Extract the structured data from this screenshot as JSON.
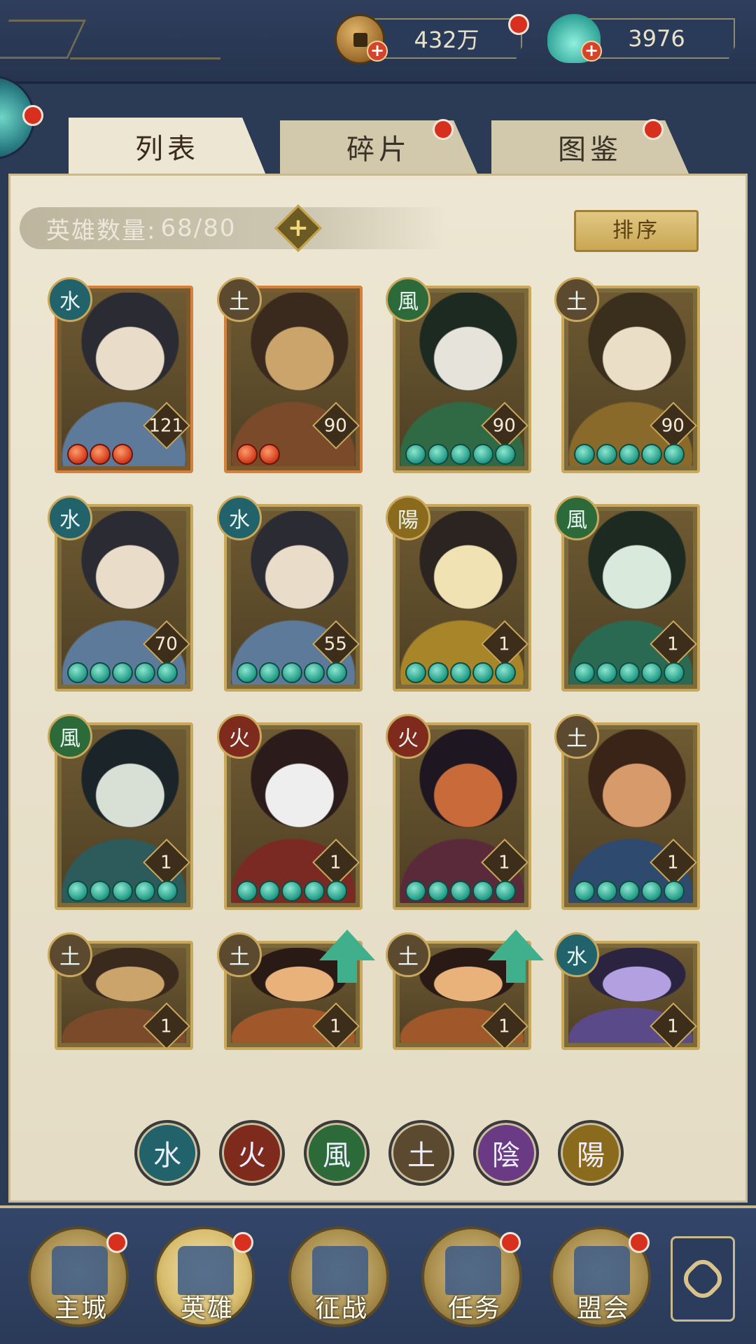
{
  "currencies": {
    "coins": {
      "value": "432万",
      "icon": "copper-coin-icon"
    },
    "shells": {
      "value": "3976",
      "icon": "jade-shell-icon"
    }
  },
  "tabs": [
    {
      "label": "列表",
      "active": true
    },
    {
      "label": "碎片",
      "active": false
    },
    {
      "label": "图鉴",
      "active": false
    }
  ],
  "hero_count": {
    "label": "英雄数量:",
    "value": "68/80"
  },
  "sort_button": {
    "label": "排序"
  },
  "heroes": [
    {
      "element": "water",
      "level": "121",
      "stars": 3,
      "star_color": "red"
    },
    {
      "element": "earth",
      "level": "90",
      "stars": 2,
      "star_color": "red"
    },
    {
      "element": "wind",
      "level": "90",
      "stars": 5,
      "star_color": "teal"
    },
    {
      "element": "earth",
      "level": "90",
      "stars": 5,
      "star_color": "teal"
    },
    {
      "element": "water",
      "level": "70",
      "stars": 5,
      "star_color": "teal"
    },
    {
      "element": "water",
      "level": "55",
      "stars": 5,
      "star_color": "teal"
    },
    {
      "element": "yang",
      "level": "1",
      "stars": 5,
      "star_color": "teal"
    },
    {
      "element": "wind",
      "level": "1",
      "stars": 5,
      "star_color": "teal"
    },
    {
      "element": "wind",
      "level": "1",
      "stars": 5,
      "star_color": "teal"
    },
    {
      "element": "fire",
      "level": "1",
      "stars": 5,
      "star_color": "teal"
    },
    {
      "element": "fire",
      "level": "1",
      "stars": 5,
      "star_color": "teal"
    },
    {
      "element": "earth",
      "level": "1",
      "stars": 5,
      "star_color": "teal"
    },
    {
      "element": "earth",
      "level": "1",
      "stars": 0,
      "star_color": "teal"
    },
    {
      "element": "earth",
      "level": "1",
      "stars": 0,
      "star_color": "teal",
      "upgradable": true
    },
    {
      "element": "earth",
      "level": "1",
      "stars": 0,
      "star_color": "teal",
      "upgradable": true
    },
    {
      "element": "water",
      "level": "1",
      "stars": 0,
      "star_color": "teal"
    }
  ],
  "element_glyphs": {
    "water": "水",
    "fire": "火",
    "wind": "風",
    "earth": "土",
    "yin": "陰",
    "yang": "陽"
  },
  "filters": [
    "water",
    "fire",
    "wind",
    "earth",
    "yin",
    "yang"
  ],
  "bottom_nav": [
    {
      "label": "主城",
      "icon": "city-icon",
      "badge": true
    },
    {
      "label": "英雄",
      "icon": "hero-icon",
      "badge": true,
      "active": true
    },
    {
      "label": "征战",
      "icon": "battle-icon",
      "badge": false
    },
    {
      "label": "任务",
      "icon": "quest-icon",
      "badge": true
    },
    {
      "label": "盟会",
      "icon": "alliance-icon",
      "badge": true
    }
  ],
  "colors": {
    "frame": "#2b3a55",
    "panel": "#ede6d2",
    "gold": "#c9a85c",
    "badge_red": "#d7301f",
    "teal_star": "#1f9a86"
  }
}
